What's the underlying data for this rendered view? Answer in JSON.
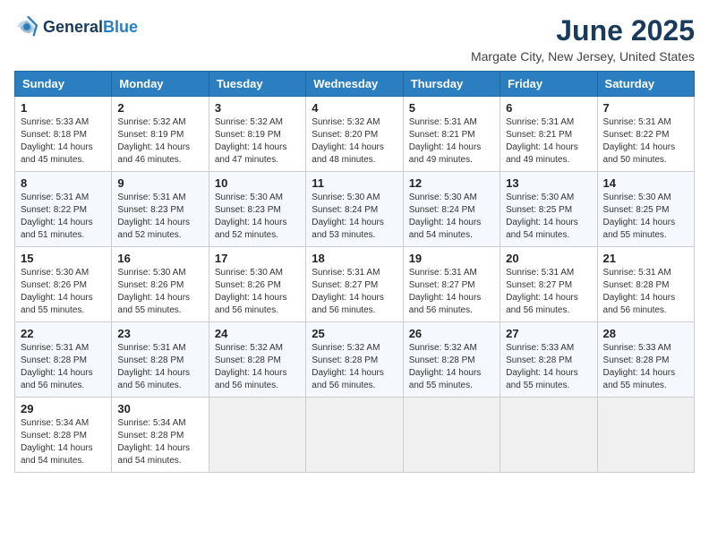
{
  "logo": {
    "general": "General",
    "blue": "Blue"
  },
  "header": {
    "month_year": "June 2025",
    "location": "Margate City, New Jersey, United States"
  },
  "columns": [
    "Sunday",
    "Monday",
    "Tuesday",
    "Wednesday",
    "Thursday",
    "Friday",
    "Saturday"
  ],
  "weeks": [
    [
      {
        "day": "1",
        "info": "Sunrise: 5:33 AM\nSunset: 8:18 PM\nDaylight: 14 hours\nand 45 minutes."
      },
      {
        "day": "2",
        "info": "Sunrise: 5:32 AM\nSunset: 8:19 PM\nDaylight: 14 hours\nand 46 minutes."
      },
      {
        "day": "3",
        "info": "Sunrise: 5:32 AM\nSunset: 8:19 PM\nDaylight: 14 hours\nand 47 minutes."
      },
      {
        "day": "4",
        "info": "Sunrise: 5:32 AM\nSunset: 8:20 PM\nDaylight: 14 hours\nand 48 minutes."
      },
      {
        "day": "5",
        "info": "Sunrise: 5:31 AM\nSunset: 8:21 PM\nDaylight: 14 hours\nand 49 minutes."
      },
      {
        "day": "6",
        "info": "Sunrise: 5:31 AM\nSunset: 8:21 PM\nDaylight: 14 hours\nand 49 minutes."
      },
      {
        "day": "7",
        "info": "Sunrise: 5:31 AM\nSunset: 8:22 PM\nDaylight: 14 hours\nand 50 minutes."
      }
    ],
    [
      {
        "day": "8",
        "info": "Sunrise: 5:31 AM\nSunset: 8:22 PM\nDaylight: 14 hours\nand 51 minutes."
      },
      {
        "day": "9",
        "info": "Sunrise: 5:31 AM\nSunset: 8:23 PM\nDaylight: 14 hours\nand 52 minutes."
      },
      {
        "day": "10",
        "info": "Sunrise: 5:30 AM\nSunset: 8:23 PM\nDaylight: 14 hours\nand 52 minutes."
      },
      {
        "day": "11",
        "info": "Sunrise: 5:30 AM\nSunset: 8:24 PM\nDaylight: 14 hours\nand 53 minutes."
      },
      {
        "day": "12",
        "info": "Sunrise: 5:30 AM\nSunset: 8:24 PM\nDaylight: 14 hours\nand 54 minutes."
      },
      {
        "day": "13",
        "info": "Sunrise: 5:30 AM\nSunset: 8:25 PM\nDaylight: 14 hours\nand 54 minutes."
      },
      {
        "day": "14",
        "info": "Sunrise: 5:30 AM\nSunset: 8:25 PM\nDaylight: 14 hours\nand 55 minutes."
      }
    ],
    [
      {
        "day": "15",
        "info": "Sunrise: 5:30 AM\nSunset: 8:26 PM\nDaylight: 14 hours\nand 55 minutes."
      },
      {
        "day": "16",
        "info": "Sunrise: 5:30 AM\nSunset: 8:26 PM\nDaylight: 14 hours\nand 55 minutes."
      },
      {
        "day": "17",
        "info": "Sunrise: 5:30 AM\nSunset: 8:26 PM\nDaylight: 14 hours\nand 56 minutes."
      },
      {
        "day": "18",
        "info": "Sunrise: 5:31 AM\nSunset: 8:27 PM\nDaylight: 14 hours\nand 56 minutes."
      },
      {
        "day": "19",
        "info": "Sunrise: 5:31 AM\nSunset: 8:27 PM\nDaylight: 14 hours\nand 56 minutes."
      },
      {
        "day": "20",
        "info": "Sunrise: 5:31 AM\nSunset: 8:27 PM\nDaylight: 14 hours\nand 56 minutes."
      },
      {
        "day": "21",
        "info": "Sunrise: 5:31 AM\nSunset: 8:28 PM\nDaylight: 14 hours\nand 56 minutes."
      }
    ],
    [
      {
        "day": "22",
        "info": "Sunrise: 5:31 AM\nSunset: 8:28 PM\nDaylight: 14 hours\nand 56 minutes."
      },
      {
        "day": "23",
        "info": "Sunrise: 5:31 AM\nSunset: 8:28 PM\nDaylight: 14 hours\nand 56 minutes."
      },
      {
        "day": "24",
        "info": "Sunrise: 5:32 AM\nSunset: 8:28 PM\nDaylight: 14 hours\nand 56 minutes."
      },
      {
        "day": "25",
        "info": "Sunrise: 5:32 AM\nSunset: 8:28 PM\nDaylight: 14 hours\nand 56 minutes."
      },
      {
        "day": "26",
        "info": "Sunrise: 5:32 AM\nSunset: 8:28 PM\nDaylight: 14 hours\nand 55 minutes."
      },
      {
        "day": "27",
        "info": "Sunrise: 5:33 AM\nSunset: 8:28 PM\nDaylight: 14 hours\nand 55 minutes."
      },
      {
        "day": "28",
        "info": "Sunrise: 5:33 AM\nSunset: 8:28 PM\nDaylight: 14 hours\nand 55 minutes."
      }
    ],
    [
      {
        "day": "29",
        "info": "Sunrise: 5:34 AM\nSunset: 8:28 PM\nDaylight: 14 hours\nand 54 minutes."
      },
      {
        "day": "30",
        "info": "Sunrise: 5:34 AM\nSunset: 8:28 PM\nDaylight: 14 hours\nand 54 minutes."
      },
      null,
      null,
      null,
      null,
      null
    ]
  ]
}
